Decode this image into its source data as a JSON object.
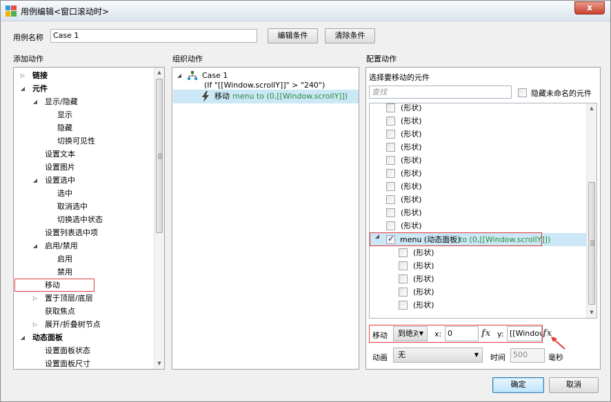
{
  "window": {
    "title": "用例编辑<窗口滚动时>",
    "close_label": "x"
  },
  "case_name": {
    "label": "用例名称",
    "value": "Case 1",
    "edit_condition": "编辑条件",
    "clear_condition": "清除条件"
  },
  "add_action": {
    "heading": "添加动作",
    "items": [
      {
        "label": "链接",
        "bold": true,
        "toggle": "▷"
      },
      {
        "label": "元件",
        "bold": true,
        "toggle": "◢"
      },
      {
        "label": "显示/隐藏",
        "toggle": "◢"
      },
      {
        "label": "显示"
      },
      {
        "label": "隐藏"
      },
      {
        "label": "切换可见性"
      },
      {
        "label": "设置文本"
      },
      {
        "label": "设置图片"
      },
      {
        "label": "设置选中",
        "toggle": "◢"
      },
      {
        "label": "选中"
      },
      {
        "label": "取消选中"
      },
      {
        "label": "切换选中状态"
      },
      {
        "label": "设置列表选中项"
      },
      {
        "label": "启用/禁用",
        "toggle": "◢"
      },
      {
        "label": "启用"
      },
      {
        "label": "禁用"
      },
      {
        "label": "移动"
      },
      {
        "label": "置于顶层/底层",
        "toggle": "▷"
      },
      {
        "label": "获取焦点"
      },
      {
        "label": "展开/折叠树节点",
        "toggle": "▷"
      },
      {
        "label": "动态面板",
        "bold": true,
        "toggle": "◢"
      },
      {
        "label": "设置面板状态"
      },
      {
        "label": "设置面板尺寸"
      }
    ]
  },
  "organize": {
    "heading": "组织动作",
    "case_label": "Case 1",
    "condition": "(If \"[[Window.scrollY]]\" > \"240\")",
    "action_verb": "移动",
    "action_detail": "menu to (0,[[Window.scrollY]])"
  },
  "configure": {
    "heading": "配置动作",
    "select_widget": "选择要移动的元件",
    "search_placeholder": "查找",
    "hide_unnamed": "隐藏未命名的元件",
    "shape_label": "(形状)",
    "menu_name": "menu (动态面板)",
    "menu_target": "to (0,[[Window.scrollY]])",
    "move_label": "移动",
    "move_mode": "到绝对位置",
    "x_label": "x:",
    "x_value": "0",
    "y_label": "y:",
    "y_value": "[[Window.scrollY]]",
    "fx": "fx",
    "animation_label": "动画",
    "animation_value": "无",
    "time_label": "时间",
    "time_value": "500",
    "ms_label": "毫秒"
  },
  "footer": {
    "ok": "确定",
    "cancel": "取消"
  },
  "icons": {
    "tree": "sitemap-icon",
    "action": "lightning-icon",
    "arrow": "red-arrow-icon"
  }
}
